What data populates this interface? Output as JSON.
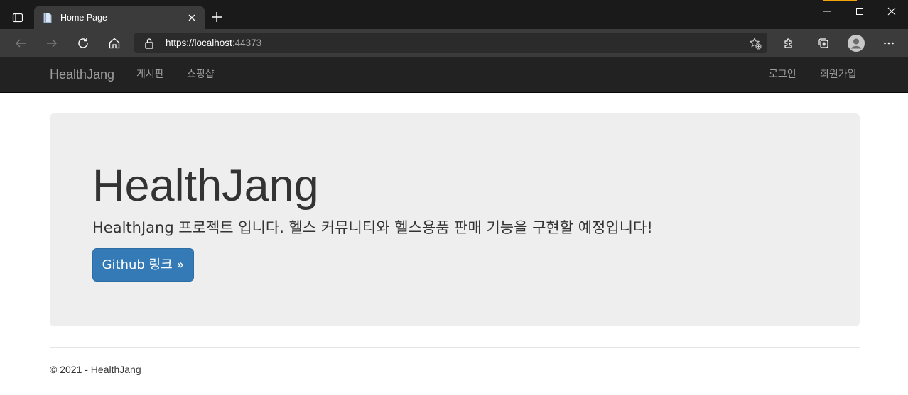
{
  "browser": {
    "tab": {
      "title": "Home Page"
    },
    "address_bar": {
      "url_main": "https://localhost",
      "url_port": ":44373"
    },
    "accent_color": "#f0a30a"
  },
  "site": {
    "navbar": {
      "brand": "HealthJang",
      "left_links": [
        "게시판",
        "쇼핑샵"
      ],
      "right_links": [
        "로그인",
        "회원가입"
      ]
    },
    "jumbotron": {
      "title": "HealthJang",
      "lead": "HealthJang 프로젝트 입니다. 헬스 커뮤니티와 헬스용품 판매 기능을 구현할 예정입니다!",
      "button_label": "Github 링크 »",
      "button_color": "#337ab7"
    },
    "footer": {
      "text": "© 2021 - HealthJang"
    }
  },
  "icons": [
    "tab-actions-icon",
    "page-favicon-icon",
    "close-icon",
    "plus-icon",
    "minimize-icon",
    "maximize-icon",
    "close-window-icon",
    "back-icon",
    "forward-icon",
    "refresh-icon",
    "home-icon",
    "lock-icon",
    "favorite-add-icon",
    "extensions-icon",
    "collections-icon",
    "profile-icon",
    "more-icon"
  ]
}
